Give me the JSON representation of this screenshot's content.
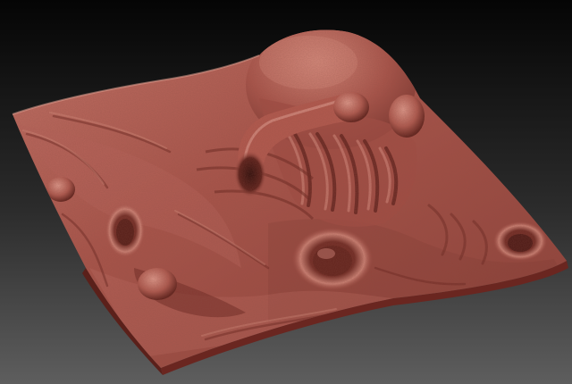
{
  "scene": {
    "subject": "sculpted-clay-terrain",
    "colors": {
      "background_top": "#050505",
      "background_bottom": "#5e5e5e",
      "clay_base": "#a9544a",
      "clay_highlight": "#d88c7f",
      "clay_shadow": "#4c1a15"
    }
  }
}
